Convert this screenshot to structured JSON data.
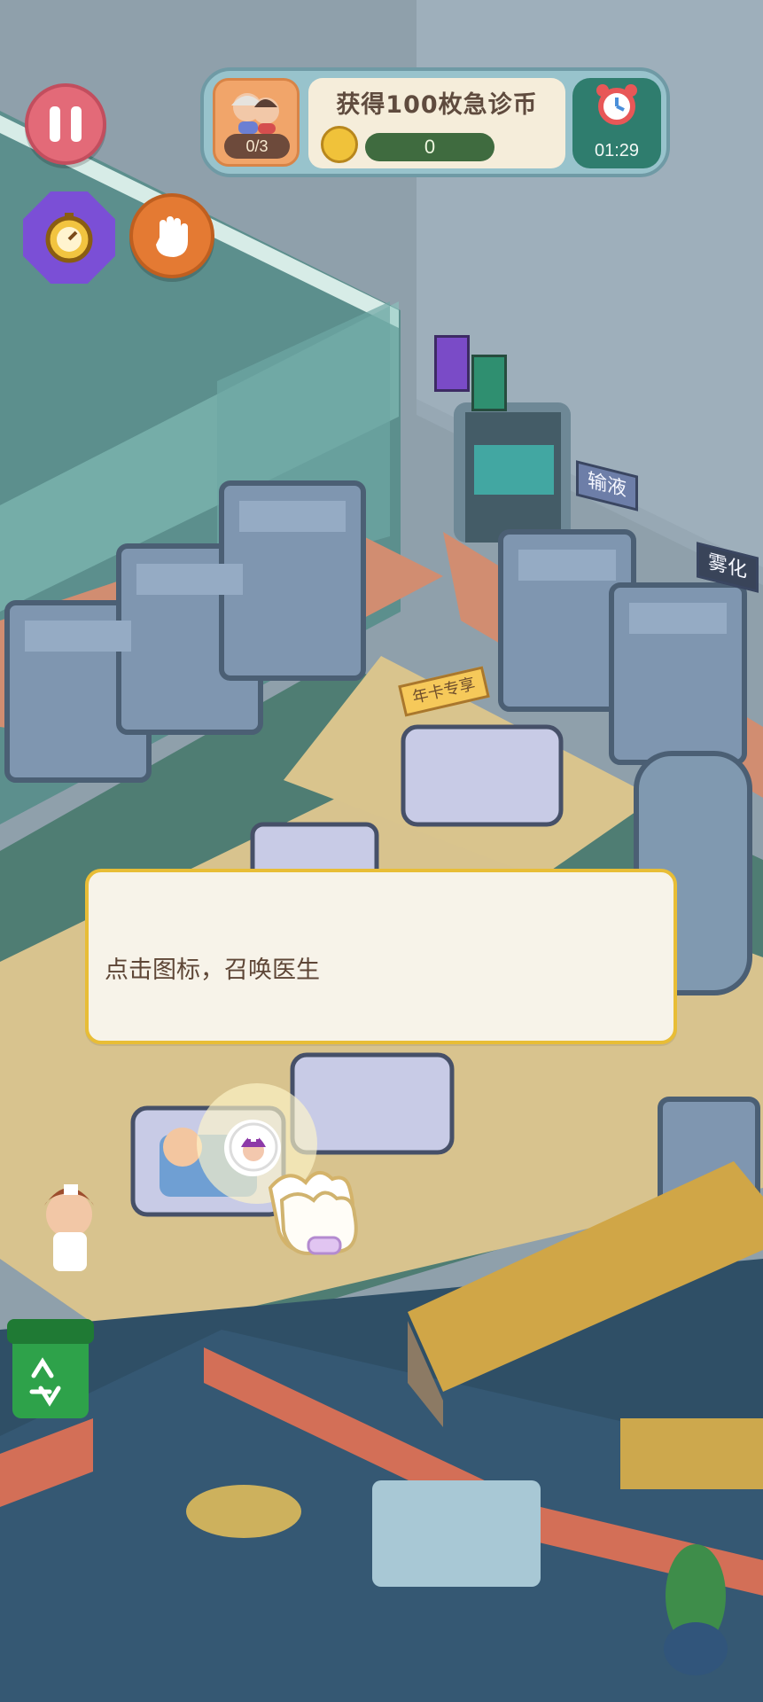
{
  "hud": {
    "patients_count": "0/3",
    "goal_title": "获得100枚急诊币",
    "coin_progress": "0",
    "timer": "01:29"
  },
  "signs": {
    "infusion": "输液",
    "nebulize": "雾化",
    "annual_card": "年卡专享"
  },
  "tutorial": {
    "text": "点击图标，召唤医生"
  },
  "colors": {
    "floor_tan": "#d8c38e",
    "room_teal": "#5f8d82",
    "dialog_border": "#e8bd36",
    "accent_orange": "#e47a33"
  },
  "icons": {
    "pause": "pause-icon",
    "hand": "hand-icon",
    "speed": "stopwatch-icon",
    "timer": "alarm-clock-icon",
    "coin": "coin-icon",
    "recycle": "recycle-bin-icon",
    "doctor": "doctor-summon-icon",
    "pointer": "pointer-hand-icon"
  }
}
